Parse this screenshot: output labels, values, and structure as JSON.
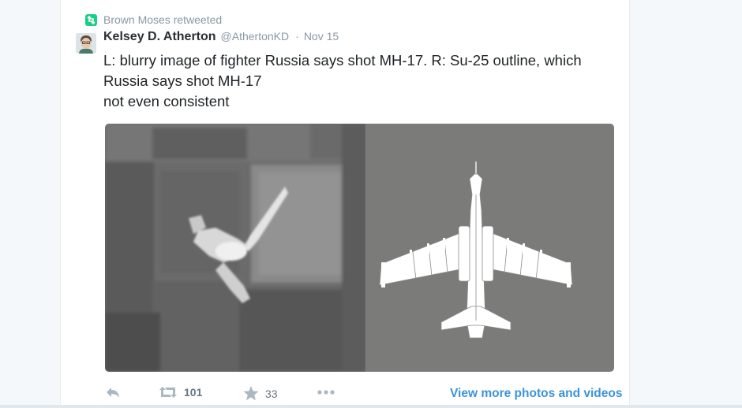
{
  "retweet": {
    "label": "Brown Moses retweeted",
    "icon": "retweet-icon"
  },
  "tweet": {
    "author_name": "Kelsey D. Atherton",
    "author_handle": "@AthertonKD",
    "separator": "·",
    "timestamp": "Nov 15",
    "text_lines": [
      "L: blurry image of fighter Russia says shot MH-17. R: Su-25 outline, which",
      "Russia says shot MH-17",
      "not even consistent"
    ]
  },
  "actions": {
    "reply_icon": "reply-icon",
    "retweet_count": "101",
    "favorite_count": "33",
    "more_icon": "more-icon"
  },
  "view_more_label": "View more photos and videos",
  "colors": {
    "background": "#f5f8fa",
    "card": "#ffffff",
    "retweet_green": "#19cf86",
    "link_blue": "#3b94d9",
    "muted": "#8899a6",
    "action_grey": "#aab8c2"
  }
}
